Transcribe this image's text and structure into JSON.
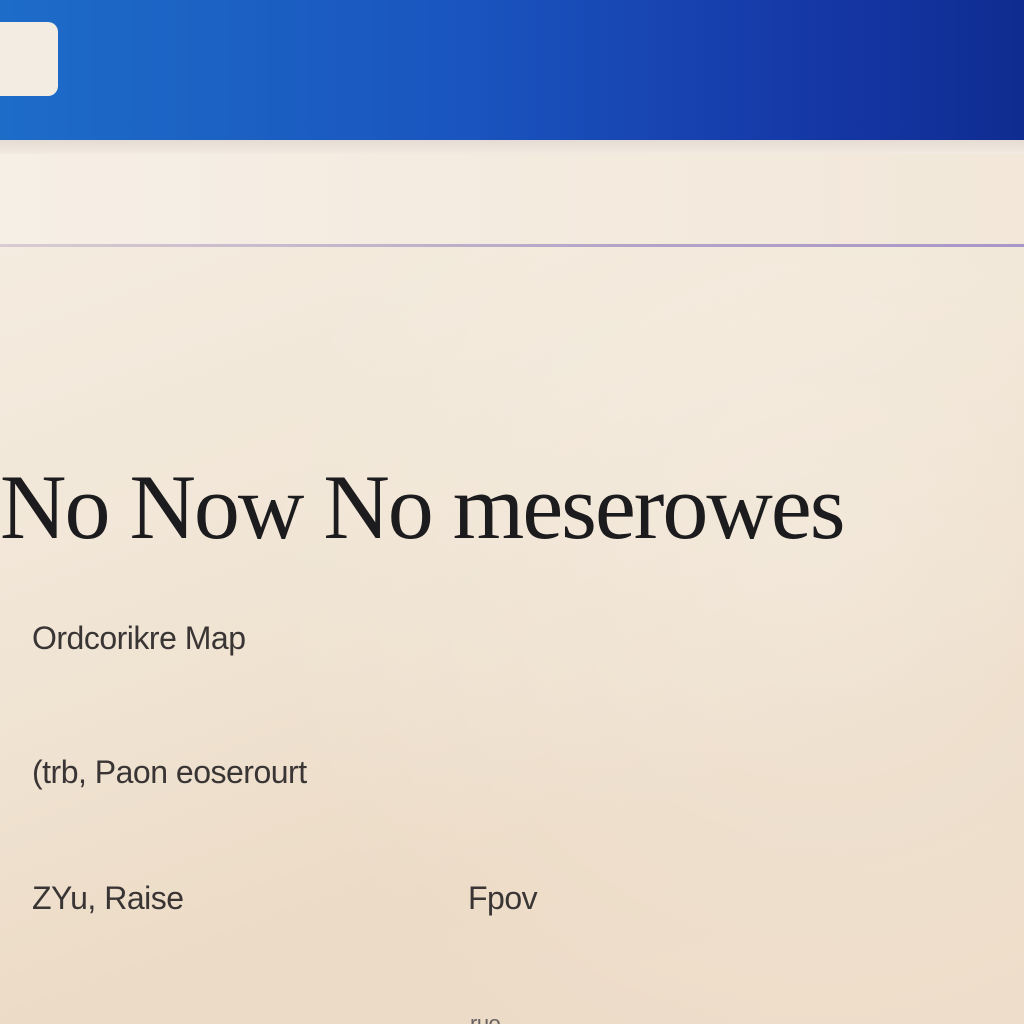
{
  "page": {
    "heading": "No Now No meserowes",
    "rows": [
      {
        "label": "Ordcorikre Map"
      },
      {
        "label": "(trb, Paon eoserourt"
      },
      {
        "label": "ZYu, Raise",
        "value": "Fpov"
      }
    ],
    "footer_fragment": "ruo"
  },
  "colors": {
    "title_bar": "#1a55bf",
    "background": "#f2e8da",
    "text": "#1c1b1d"
  }
}
